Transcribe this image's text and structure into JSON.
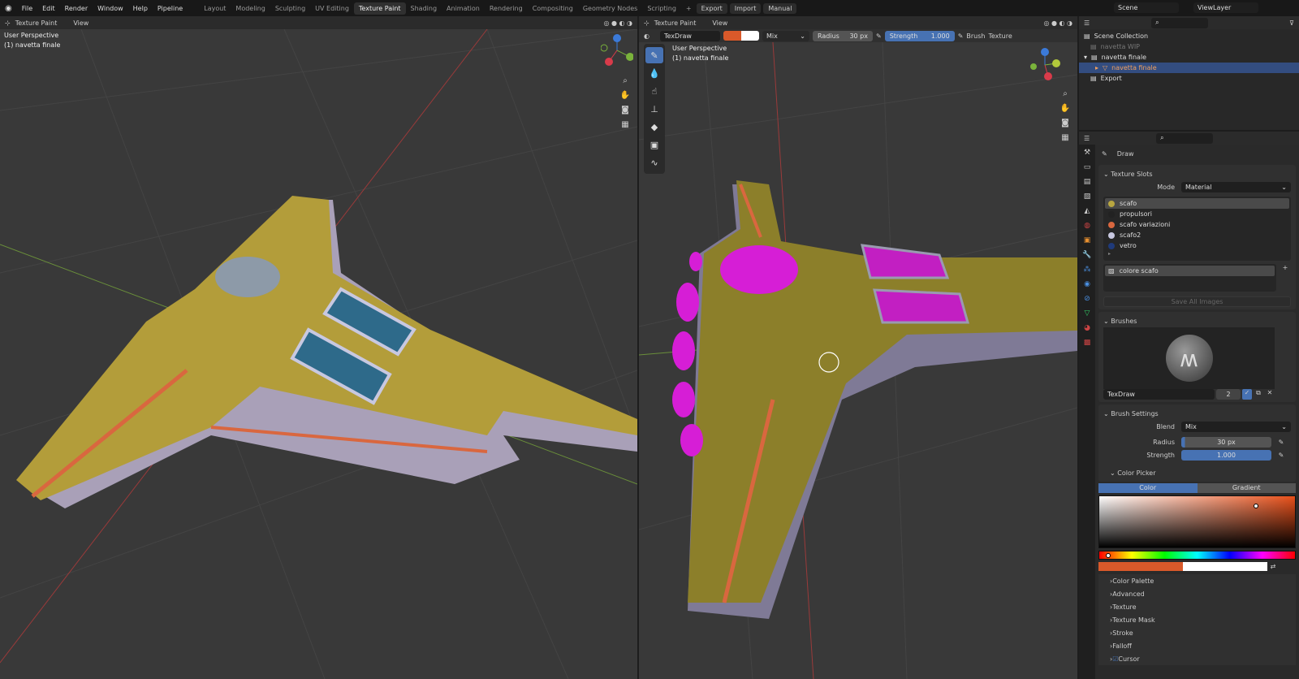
{
  "topbar": {
    "menus": [
      "File",
      "Edit",
      "Render",
      "Window",
      "Help",
      "Pipeline"
    ],
    "workspaces": [
      "Layout",
      "Modeling",
      "Sculpting",
      "UV Editing",
      "Texture Paint",
      "Shading",
      "Animation",
      "Rendering",
      "Compositing",
      "Geometry Nodes",
      "Scripting"
    ],
    "active_workspace": "Texture Paint",
    "add_label": "+",
    "addon_buttons": [
      "Export",
      "Import",
      "Manual"
    ],
    "scene": "Scene",
    "view_layer": "ViewLayer"
  },
  "left_viewport": {
    "mode": "Texture Paint",
    "view_menu": "View",
    "perspective": "User Perspective",
    "object": "(1) navetta finale"
  },
  "right_viewport": {
    "mode": "Texture Paint",
    "view_menu": "View",
    "perspective": "User Perspective",
    "object": "(1) navetta finale",
    "brush_name": "TexDraw",
    "primary_color": "#d9592a",
    "secondary_color": "#ffffff",
    "blend": "Mix",
    "radius_label": "Radius",
    "radius": "30 px",
    "strength_label": "Strength",
    "strength": "1.000",
    "brush_menu": "Brush",
    "texture_menu": "Texture"
  },
  "outliner": {
    "items": [
      {
        "label": "Scene Collection",
        "level": 0
      },
      {
        "label": "navetta WIP",
        "level": 1,
        "dim": true
      },
      {
        "label": "navetta finale",
        "level": 1
      },
      {
        "label": "navetta finale",
        "level": 2,
        "selected": true
      },
      {
        "label": "Export",
        "level": 1
      }
    ]
  },
  "properties": {
    "tool_name": "Draw",
    "texture_slots": {
      "title": "Texture Slots",
      "mode_label": "Mode",
      "mode": "Material",
      "materials": [
        {
          "name": "scafo",
          "color": "#b8a640"
        },
        {
          "name": "propulsori",
          "color": "#222222"
        },
        {
          "name": "scafo variazioni",
          "color": "#d9673f"
        },
        {
          "name": "scafo2",
          "color": "#c8c8e0"
        },
        {
          "name": "vetro",
          "color": "#1f3a7a"
        }
      ],
      "image": "colore scafo",
      "save_all": "Save All Images"
    },
    "brushes": {
      "title": "Brushes",
      "name": "TexDraw",
      "users": "2"
    },
    "brush_settings": {
      "title": "Brush Settings",
      "blend_label": "Blend",
      "blend": "Mix",
      "radius_label": "Radius",
      "radius": "30 px",
      "strength_label": "Strength",
      "strength": "1.000",
      "strength_fraction": 1.0
    },
    "color_picker": {
      "title": "Color Picker",
      "tabs": [
        "Color",
        "Gradient"
      ],
      "active_tab": "Color",
      "primary": "#d9592a",
      "secondary": "#ffffff"
    },
    "subpanels": [
      "Color Palette",
      "Advanced",
      "Texture",
      "Texture Mask",
      "Stroke",
      "Falloff",
      "Cursor"
    ]
  },
  "colors": {
    "accent": "#4772b3",
    "viewport_bg": "#393939"
  }
}
